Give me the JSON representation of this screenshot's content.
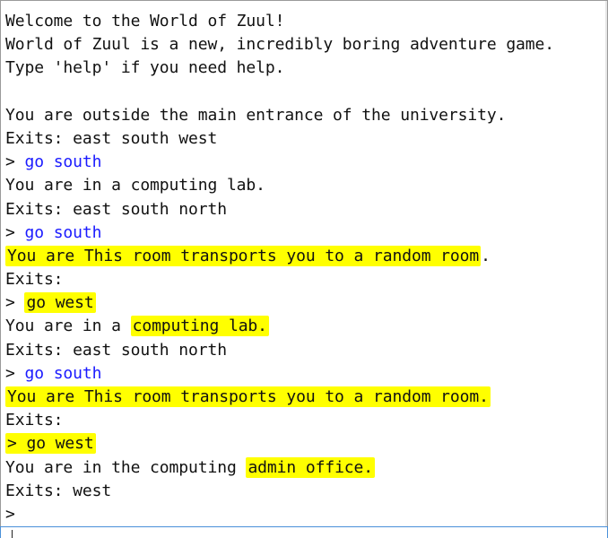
{
  "terminal": {
    "lines": [
      {
        "segments": [
          {
            "text": "Welcome to the World of Zuul!"
          }
        ]
      },
      {
        "segments": [
          {
            "text": "World of Zuul is a new, incredibly boring adventure game."
          }
        ]
      },
      {
        "segments": [
          {
            "text": "Type 'help' if you need help."
          }
        ]
      },
      {
        "segments": [
          {
            "text": ""
          }
        ]
      },
      {
        "segments": [
          {
            "text": "You are outside the main entrance of the university."
          }
        ]
      },
      {
        "segments": [
          {
            "text": "Exits: east south west"
          }
        ]
      },
      {
        "segments": [
          {
            "text": "> "
          },
          {
            "text": "go south",
            "style": "cmd"
          }
        ]
      },
      {
        "segments": [
          {
            "text": "You are in a computing lab."
          }
        ]
      },
      {
        "segments": [
          {
            "text": "Exits: east south north"
          }
        ]
      },
      {
        "segments": [
          {
            "text": "> "
          },
          {
            "text": "go south",
            "style": "cmd"
          }
        ]
      },
      {
        "segments": [
          {
            "text": "You are This room transports you to a random room",
            "highlight": true
          },
          {
            "text": "."
          }
        ]
      },
      {
        "segments": [
          {
            "text": "Exits:"
          }
        ]
      },
      {
        "segments": [
          {
            "text": "> "
          },
          {
            "text": "go west",
            "highlight": true
          }
        ]
      },
      {
        "segments": [
          {
            "text": "You are in a "
          },
          {
            "text": "computing lab.",
            "highlight": true
          }
        ]
      },
      {
        "segments": [
          {
            "text": "Exits: east south north"
          }
        ]
      },
      {
        "segments": [
          {
            "text": "> "
          },
          {
            "text": "go south",
            "style": "cmd"
          }
        ]
      },
      {
        "segments": [
          {
            "text": "You are This room transports you to a random room.",
            "highlight": true
          }
        ]
      },
      {
        "segments": [
          {
            "text": "Exits:"
          }
        ]
      },
      {
        "segments": [
          {
            "text": "> go west",
            "highlight": true
          }
        ]
      },
      {
        "segments": [
          {
            "text": "You are in the computing "
          },
          {
            "text": "admin office.",
            "highlight": true
          }
        ]
      },
      {
        "segments": [
          {
            "text": "Exits: west"
          }
        ]
      },
      {
        "segments": [
          {
            "text": ">"
          }
        ]
      }
    ]
  },
  "input": {
    "value": ""
  },
  "colors": {
    "command": "#1a1aff",
    "highlight": "#ffff00",
    "text": "#111111"
  }
}
